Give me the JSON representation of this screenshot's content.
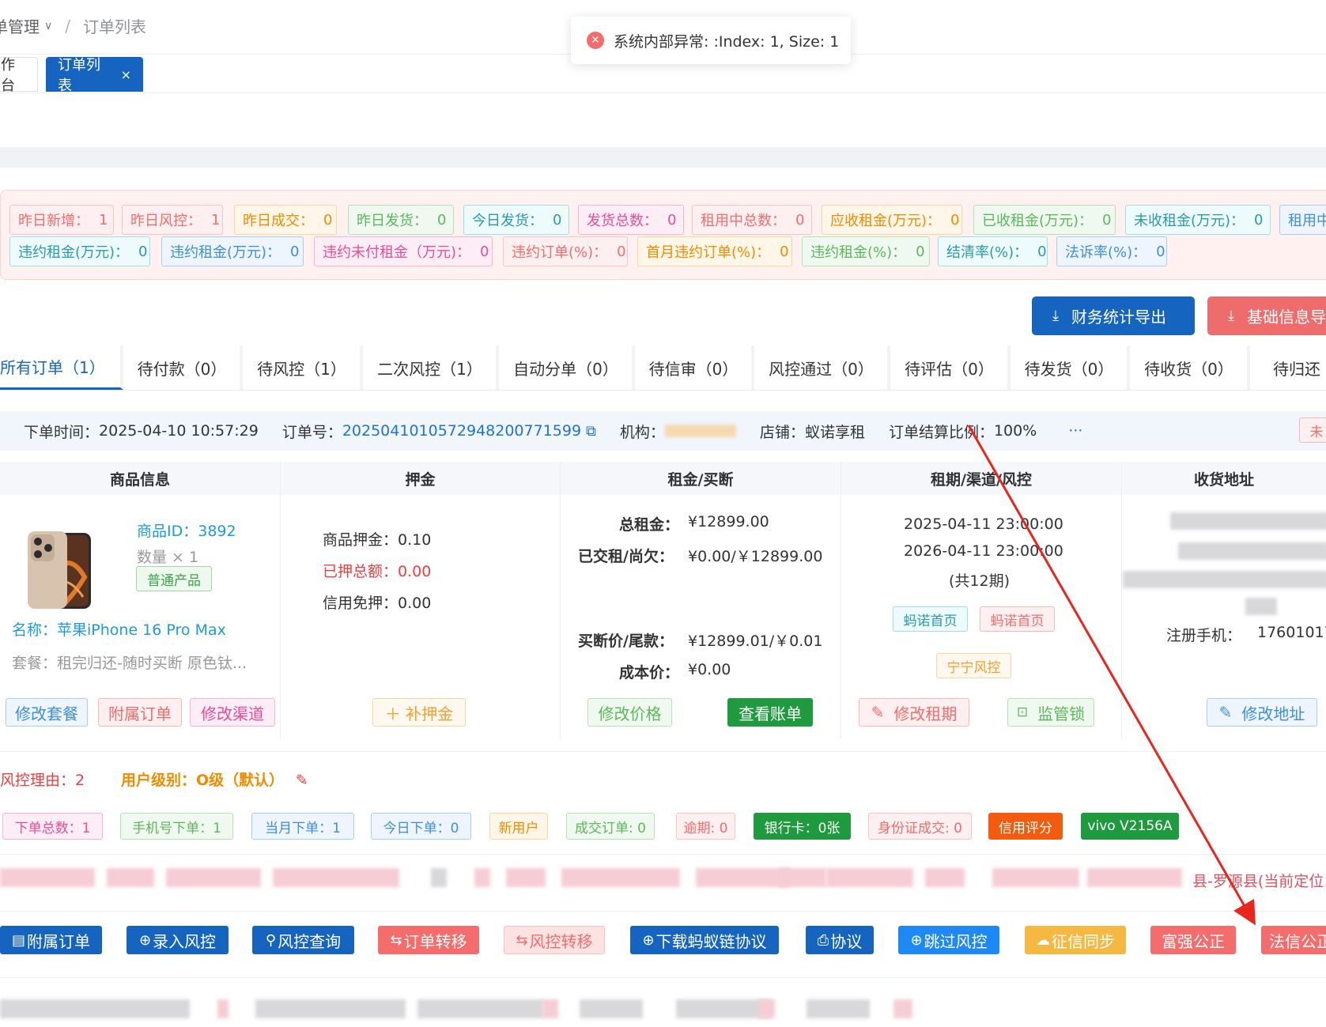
{
  "breadcrumb": {
    "parent": "单管理",
    "current": "订单列表"
  },
  "toast": {
    "message": "系统内部异常: :Index: 1, Size: 1"
  },
  "tags": {
    "workbench": "作台",
    "orders": "订单列表",
    "close": "×"
  },
  "stats": [
    {
      "label": "昨日新增：",
      "value": "1"
    },
    {
      "label": "昨日风控：",
      "value": "1"
    },
    {
      "label": "昨日成交：",
      "value": "0"
    },
    {
      "label": "昨日发货：",
      "value": "0"
    },
    {
      "label": "今日发货：",
      "value": "0"
    },
    {
      "label": "发货总数：",
      "value": "0"
    },
    {
      "label": "租用中总数：",
      "value": "0"
    },
    {
      "label": "应收租金(万元)：",
      "value": "0"
    },
    {
      "label": "已收租金(万元)：",
      "value": "0"
    },
    {
      "label": "未收租金(万元)：",
      "value": "0"
    },
    {
      "label": "租用中",
      "value": ""
    },
    {
      "label": "违约租金(万元)：",
      "value": "0"
    },
    {
      "label": "违约租金(万元)：",
      "value": "0"
    },
    {
      "label": "违约未付租金（万元)：",
      "value": "0"
    },
    {
      "label": "违约订单(%)：",
      "value": "0"
    },
    {
      "label": "首月违约订单(%)：",
      "value": "0"
    },
    {
      "label": "违约租金(%)：",
      "value": "0"
    },
    {
      "label": "结清率(%)：",
      "value": "0"
    },
    {
      "label": "法诉率(%)：",
      "value": "0"
    }
  ],
  "export": {
    "finance": "财务统计导出",
    "basic": "基础信息导"
  },
  "status_tabs": [
    "所有订单（1）",
    "待付款（0）",
    "待风控（1）",
    "二次风控（1）",
    "自动分单（0）",
    "待信审（0）",
    "风控通过（0）",
    "待评估（0）",
    "待发货（0）",
    "待收货（0）",
    "待归还"
  ],
  "order": {
    "time_label": "下单时间：",
    "time": "2025-04-10 10:57:29",
    "no_label": "订单号：",
    "no": "2025041010572948200771599",
    "org_label": "机构：",
    "shop_label": "店铺：",
    "shop": "蚁诺享租",
    "ratio_label": "订单结算比例：",
    "ratio": "100%",
    "more": "···",
    "corner": "未"
  },
  "columns": [
    "商品信息",
    "押金",
    "租金/买断",
    "租期/渠道/风控",
    "收货地址"
  ],
  "product": {
    "id": "商品ID：3892",
    "qty": "数量 × 1",
    "type": "普通产品",
    "name": "名称：苹果iPhone 16 Pro Max",
    "package": "套餐：租完归还-随时买断 原色钛...",
    "btn_pkg": "修改套餐",
    "btn_sub": "附属订单",
    "btn_channel": "修改渠道"
  },
  "deposit": {
    "goods": "商品押金：0.10",
    "paid": "已押总额：0.00",
    "credit": "信用免押：0.00",
    "btn": "＋ 补押金"
  },
  "rent": {
    "total_label": "总租金：",
    "total": "¥12899.00",
    "paid_label": "已交租/尚欠：",
    "paid": "¥0.00/￥12899.00",
    "buyout_label": "买断价/尾款：",
    "buyout": "¥12899.01/￥0.01",
    "cost_label": "成本价：",
    "cost": "¥0.00",
    "btn_price": "修改价格",
    "btn_bill": "查看账单"
  },
  "term": {
    "start": "2025-04-11 23:00:00",
    "end": "2026-04-11 23:00:00",
    "periods": "(共12期)",
    "tag1": "蚂诺首页",
    "tag2": "蚂诺首页",
    "risk": "宁宁风控",
    "btn_term": "修改租期",
    "btn_lock": "监管锁"
  },
  "address": {
    "phone_label": "注册手机：",
    "phone": "17601017",
    "btn": "修改地址"
  },
  "risk": {
    "reason": "风控理由：2",
    "level": "用户级别：O级（默认）"
  },
  "badges": [
    {
      "text": "下单总数：1",
      "kind": "pink-outline"
    },
    {
      "text": "手机号下单：1",
      "kind": "green-outline"
    },
    {
      "text": "当月下单：1",
      "kind": "blue-outline"
    },
    {
      "text": "今日下单：0",
      "kind": "blue-outline"
    },
    {
      "text": "新用户",
      "kind": "orange-outline"
    },
    {
      "text": "成交订单: 0",
      "kind": "green-outline"
    },
    {
      "text": "逾期: 0",
      "kind": "red-outline"
    },
    {
      "text": "银行卡：0张",
      "kind": "green-solid"
    },
    {
      "text": "身份证成交: 0",
      "kind": "red-outline"
    },
    {
      "text": "信用评分",
      "kind": "orange-solid"
    },
    {
      "text": "vivo V2156A",
      "kind": "green-solid"
    }
  ],
  "location_text": "县-罗源县(当前定位",
  "actions": [
    {
      "text": "附属订单",
      "icon": "▤",
      "color": "#1565c0"
    },
    {
      "text": "录入风控",
      "icon": "⊕",
      "color": "#1565c0"
    },
    {
      "text": "风控查询",
      "icon": "⚲",
      "color": "#1565c0"
    },
    {
      "text": "订单转移",
      "icon": "⇆",
      "color": "#f56c6c"
    },
    {
      "text": "风控转移",
      "icon": "⇆",
      "color": "#fde2e2"
    },
    {
      "text": "下载蚂蚁链协议",
      "icon": "⊕",
      "color": "#1565c0"
    },
    {
      "text": "协议",
      "icon": "⎙",
      "color": "#1565c0"
    },
    {
      "text": "跳过风控",
      "icon": "⊕",
      "color": "#1e88f5"
    },
    {
      "text": "征信同步",
      "icon": "☁",
      "color": "#f5b942"
    },
    {
      "text": "富强公正",
      "icon": "",
      "color": "#f56c6c"
    },
    {
      "text": "法信公正",
      "icon": "",
      "color": "#f56c6c"
    }
  ]
}
